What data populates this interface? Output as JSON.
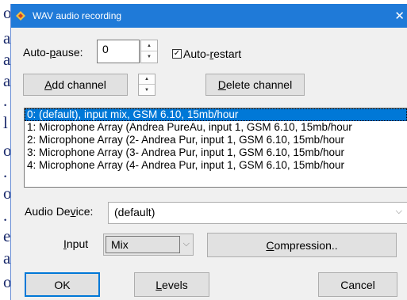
{
  "background_doc": {
    "glyphs": [
      "o",
      "a",
      "a",
      "a",
      ".",
      "l",
      "o",
      ".",
      "o",
      ".",
      "e",
      "a",
      "o"
    ]
  },
  "window": {
    "title": "WAV audio recording",
    "close_glyph": "✕"
  },
  "autopause": {
    "label_pre": "Auto-",
    "label_u": "p",
    "label_post": "ause:",
    "value": "0"
  },
  "autorestart": {
    "checked_glyph": "✓",
    "label_pre": "Auto-",
    "label_u": "r",
    "label_post": "estart"
  },
  "buttons": {
    "add_u": "A",
    "add_rest": "dd channel",
    "delete_u": "D",
    "delete_rest": "elete channel",
    "compression_u": "C",
    "compression_rest": "ompression..",
    "ok": "OK",
    "levels_u": "L",
    "levels_rest": "evels",
    "cancel": "Cancel"
  },
  "channels": [
    "0: (default), input mix, GSM 6.10, 15mb/hour",
    "1: Microphone Array (Andrea PureAu, input 1, GSM 6.10, 15mb/hour",
    "2: Microphone Array (2- Andrea Pur, input 1, GSM 6.10, 15mb/hour",
    "3: Microphone Array (3- Andrea Pur, input 1, GSM 6.10, 15mb/hour",
    "4: Microphone Array (4- Andrea Pur, input 1, GSM 6.10, 15mb/hour"
  ],
  "audio_device": {
    "label_pre": "Audio De",
    "label_u": "v",
    "label_post": "ice:",
    "value": "(default)"
  },
  "input": {
    "label_u": "I",
    "label_rest": "nput",
    "value": "Mix"
  },
  "colors": {
    "titlebar": "#1f7ad8",
    "selection": "#0078d7",
    "dialog_bg": "#f0f0f0"
  }
}
